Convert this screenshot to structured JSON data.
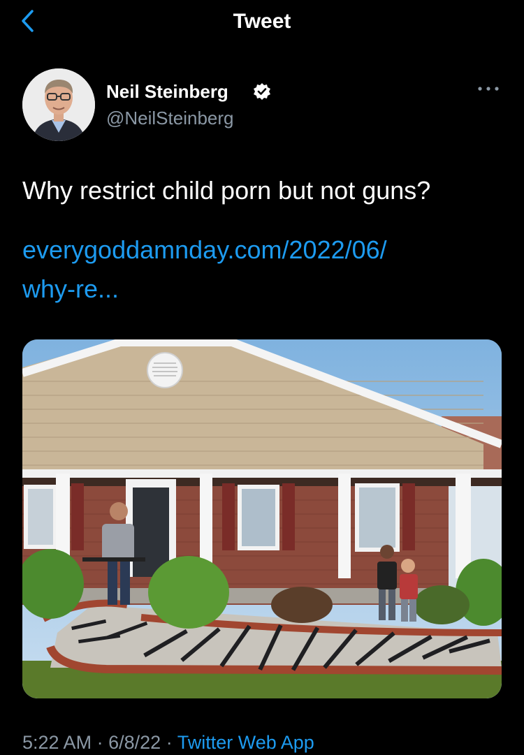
{
  "header": {
    "title": "Tweet",
    "back_icon": "chevron-left-icon"
  },
  "author": {
    "display_name": "Neil Steinberg",
    "handle": "@NeilSteinberg",
    "verified_icon": "verified-badge-icon",
    "more_icon": "more-horizontal-icon"
  },
  "tweet": {
    "text": "Why restrict child porn but not guns?",
    "link_line1": "everygoddamnday.com/2022/06/",
    "link_line2": "why-re..."
  },
  "meta": {
    "time": "5:22 AM",
    "separator": "·",
    "date": "6/8/22",
    "source": "Twitter Web App"
  },
  "colors": {
    "background": "#000000",
    "accent": "#1d9bf0",
    "secondary_text": "#8b98a5"
  }
}
